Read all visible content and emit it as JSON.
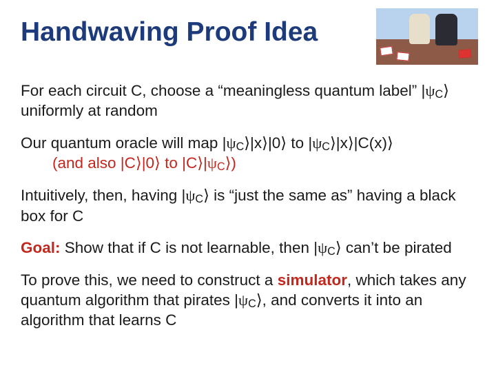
{
  "title": "Handwaving Proof Idea",
  "p1a": "For each circuit C, choose a “meaningless quantum label” |",
  "psi": "ψ",
  "subC": "C",
  "ket": "⟩",
  "p1b": " uniformly at random",
  "p2a": "Our quantum oracle will map |",
  "p2b": "|x",
  "p2c": "|0",
  "p2d": " to |",
  "p2e": "|C(x)",
  "indent_a": "(and also |C",
  "indent_b": " to |C",
  "indent_c": "|",
  "indent_d": ")",
  "p3a": "Intuitively, then, having |",
  "p3b": " is “just the same as” having a black box for C",
  "goal_label": "Goal:",
  "p4a": " Show that if C is not learnable, then |",
  "p4b": " can’t be pirated",
  "p5a": "To prove this, we need to construct a ",
  "sim_label": "simulator",
  "p5b": ", which takes any quantum algorithm that pirates |",
  "p5c": ", and converts it into an algorithm that learns C",
  "img_alt": "photo-queen-waving"
}
